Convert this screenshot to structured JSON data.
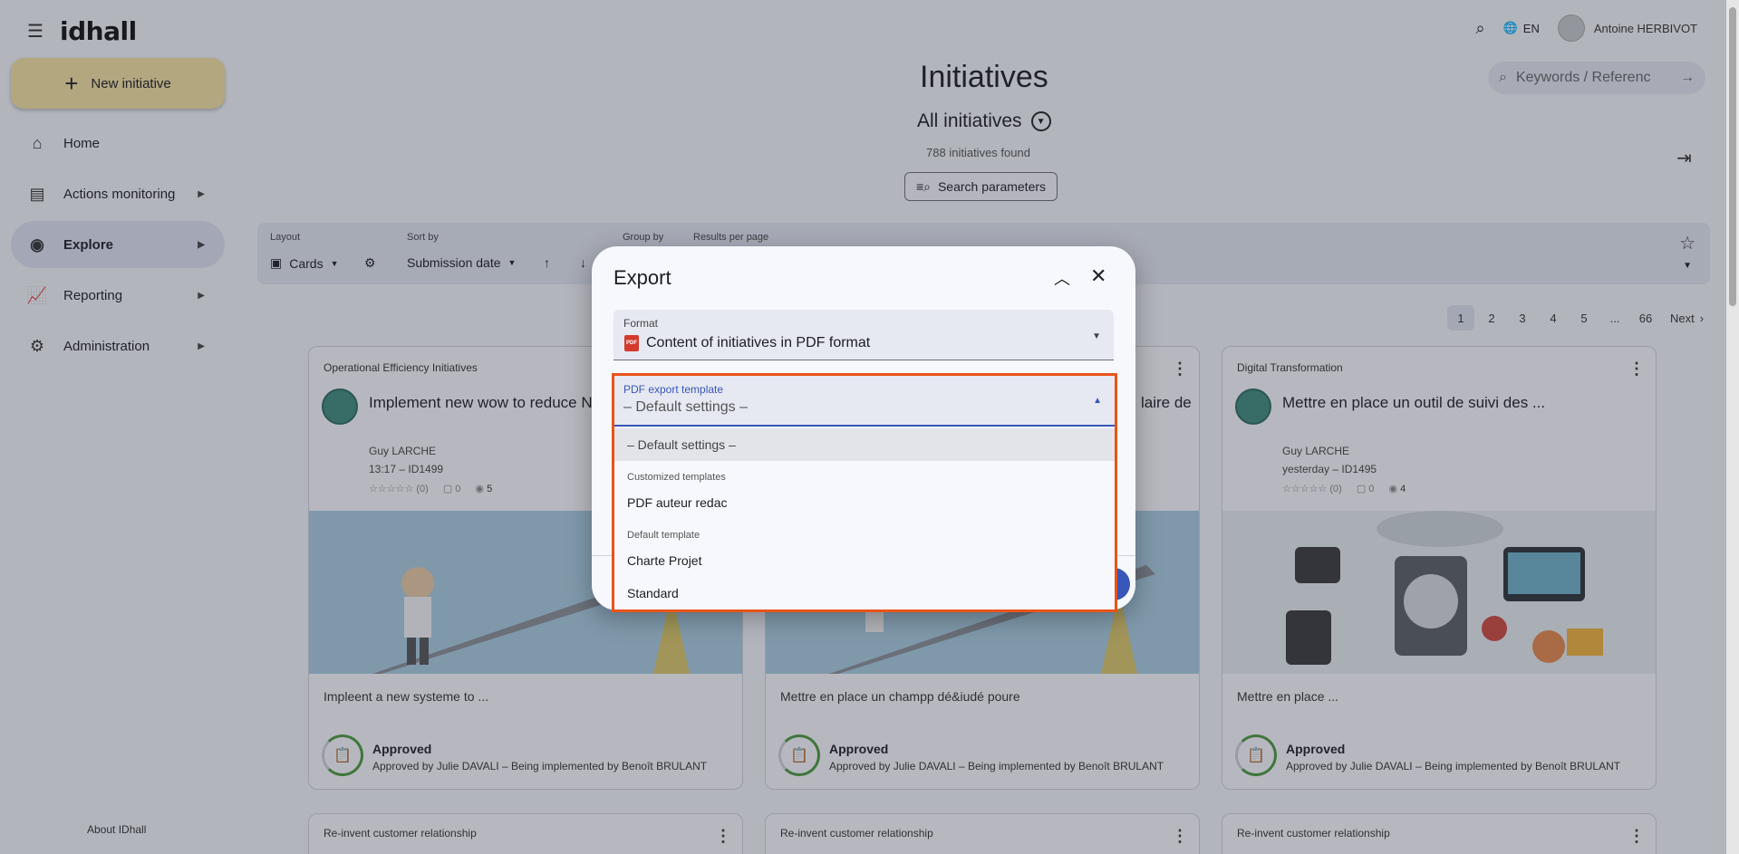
{
  "app": {
    "logo": "idhall"
  },
  "sidebar": {
    "new_initiative": "New initiative",
    "items": [
      {
        "label": "Home",
        "icon": "home-icon"
      },
      {
        "label": "Actions monitoring",
        "icon": "clipboard-icon"
      },
      {
        "label": "Explore",
        "icon": "compass-icon"
      },
      {
        "label": "Reporting",
        "icon": "chart-icon"
      },
      {
        "label": "Administration",
        "icon": "gear-icon"
      }
    ],
    "about": "About IDhall"
  },
  "header": {
    "language": "EN",
    "user": "Antoine HERBIVOT",
    "search_placeholder": "Keywords / Referenc"
  },
  "main": {
    "title": "Initiatives",
    "subtitle": "All initiatives",
    "count": "788",
    "count_suffix": "initiatives found",
    "search_params": "Search parameters"
  },
  "toolbar": {
    "layout_label": "Layout",
    "layout_value": "Cards",
    "sort_label": "Sort by",
    "sort_value": "Submission date",
    "group_label": "Group by",
    "results_label": "Results per page"
  },
  "pagination": {
    "pages": [
      "1",
      "2",
      "3",
      "4",
      "5",
      "...",
      "66"
    ],
    "next": "Next",
    "current": "1"
  },
  "cards": [
    {
      "category": "Operational Efficiency Initiatives",
      "title": "Implement new wow to reduce NC",
      "author": "Guy LARCHE",
      "meta": "13:17 – ID1499",
      "rating": "(0)",
      "comments": "0",
      "views": "5",
      "desc": "Impleent a new systeme to ...",
      "status": "Approved",
      "approved_by": "Approved by Julie DAVALI – Being implemented by Benoît BRULANT"
    },
    {
      "category": "",
      "title": "laire de",
      "author": "",
      "meta": "",
      "rating": "",
      "comments": "",
      "views": "",
      "desc": "Mettre en place un champp dé&iudé poure",
      "status": "Approved",
      "approved_by": "Approved by Julie DAVALI – Being implemented by Benoît BRULANT"
    },
    {
      "category": "Digital Transformation",
      "title": "Mettre en place un outil de suivi des ...",
      "author": "Guy LARCHE",
      "meta": "yesterday – ID1495",
      "rating": "(0)",
      "comments": "0",
      "views": "4",
      "desc": "Mettre en place ...",
      "status": "Approved",
      "approved_by": "Approved by Julie DAVALI – Being implemented by Benoît BRULANT"
    }
  ],
  "bottom_cards": [
    "Re-invent customer relationship",
    "Re-invent customer relationship",
    "Re-invent customer relationship"
  ],
  "dialog": {
    "title": "Export",
    "format_label": "Format",
    "format_value": "Content of initiatives in PDF format",
    "pdf_icon_text": "PDF",
    "template_label": "PDF export template",
    "template_value": "– Default settings –",
    "options": {
      "default": "– Default settings –",
      "group_custom": "Customized templates",
      "custom_1": "PDF auteur redac",
      "group_default": "Default template",
      "default_1": "Charte Projet",
      "default_2": "Standard"
    }
  },
  "colors": {
    "accent": "#3857b8",
    "new_button": "#f4e2a0",
    "highlight": "#e8541a",
    "approved": "#4c9a3e"
  }
}
